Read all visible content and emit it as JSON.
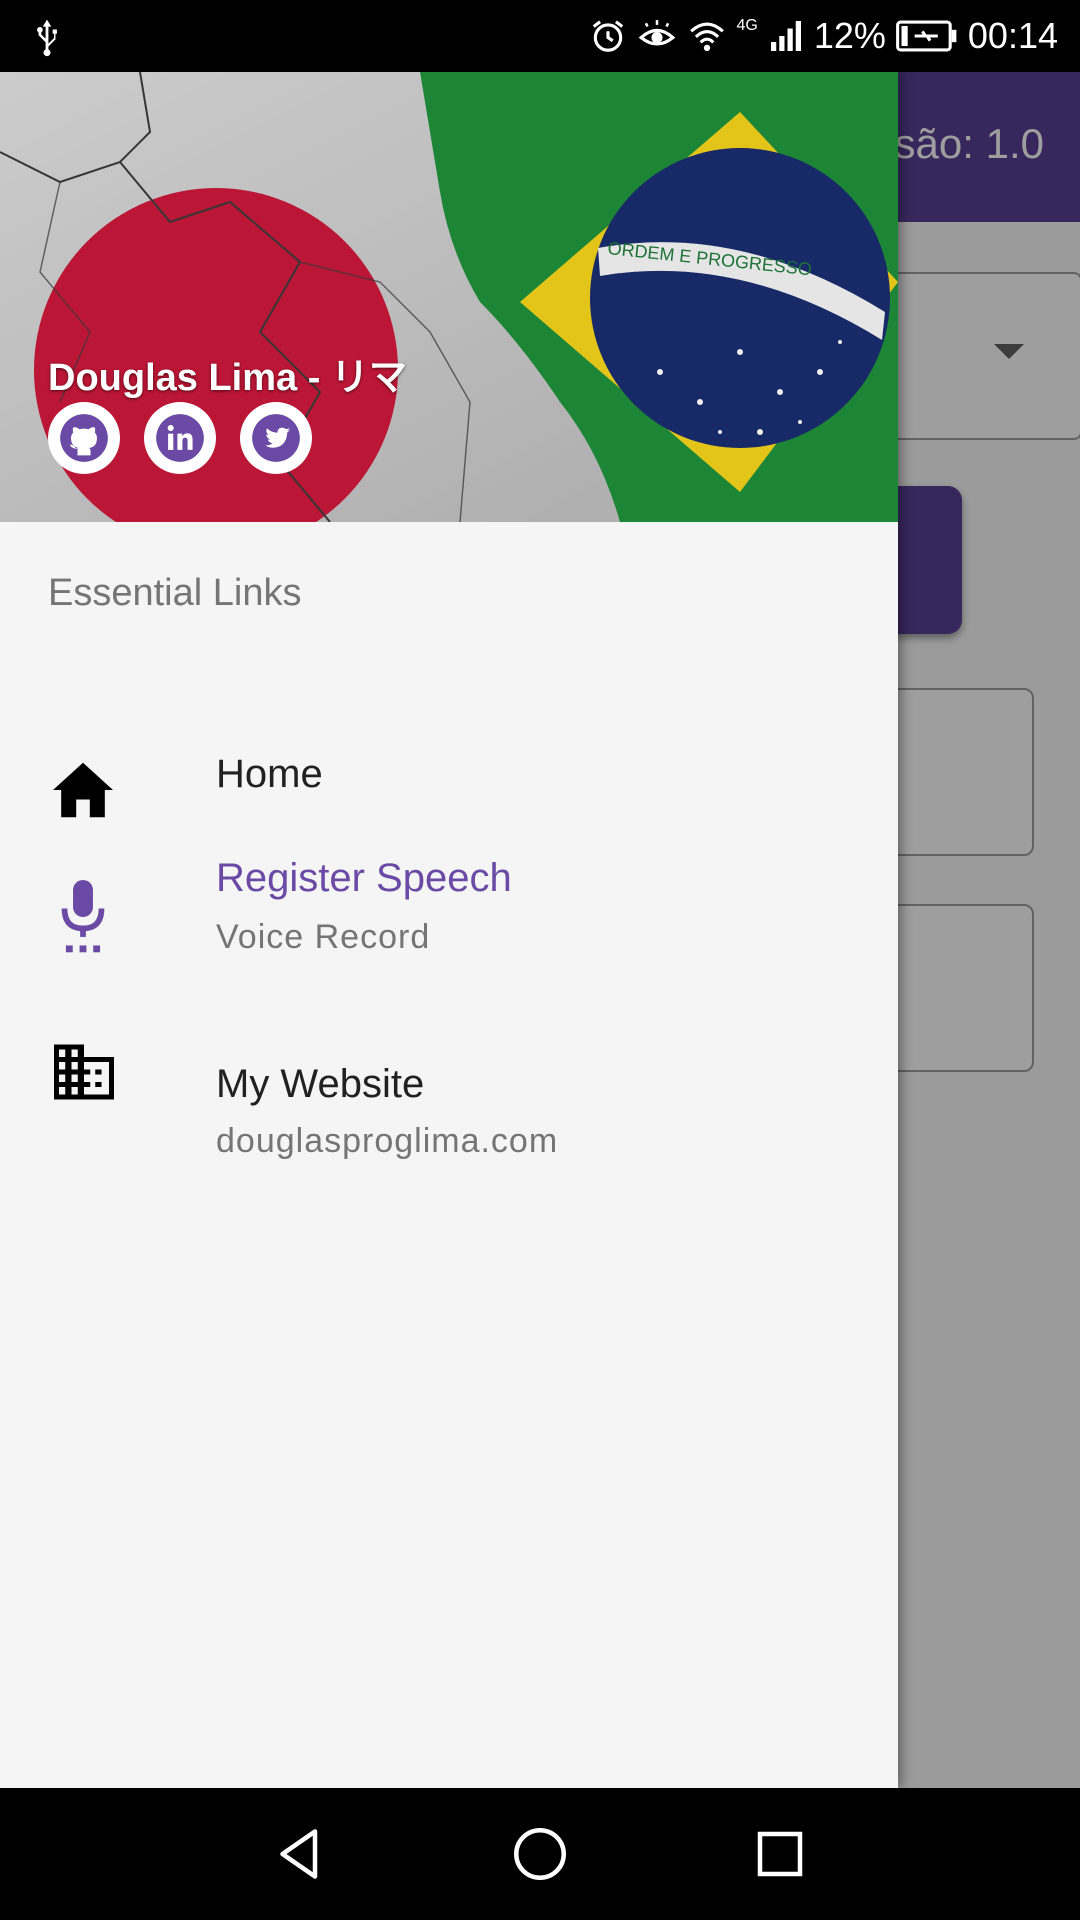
{
  "status_bar": {
    "battery": "12%",
    "time": "00:14",
    "network": "4G"
  },
  "background_app": {
    "version_label": "são: 1.0"
  },
  "drawer": {
    "user_name": "Douglas Lima - リマ",
    "social": [
      {
        "icon": "github-icon"
      },
      {
        "icon": "linkedin-icon"
      },
      {
        "icon": "twitter-icon"
      }
    ],
    "section_title": "Essential Links",
    "items": [
      {
        "icon": "home-icon",
        "title": "Home",
        "subtitle": ""
      },
      {
        "icon": "mic-icon",
        "title": "Register Speech",
        "subtitle": "Voice Record",
        "active": true
      },
      {
        "icon": "business-icon",
        "title": "My Website",
        "subtitle": "douglasproglima.com"
      }
    ]
  },
  "colors": {
    "accent": "#6a4aa5",
    "appbar": "#5b3f95"
  }
}
